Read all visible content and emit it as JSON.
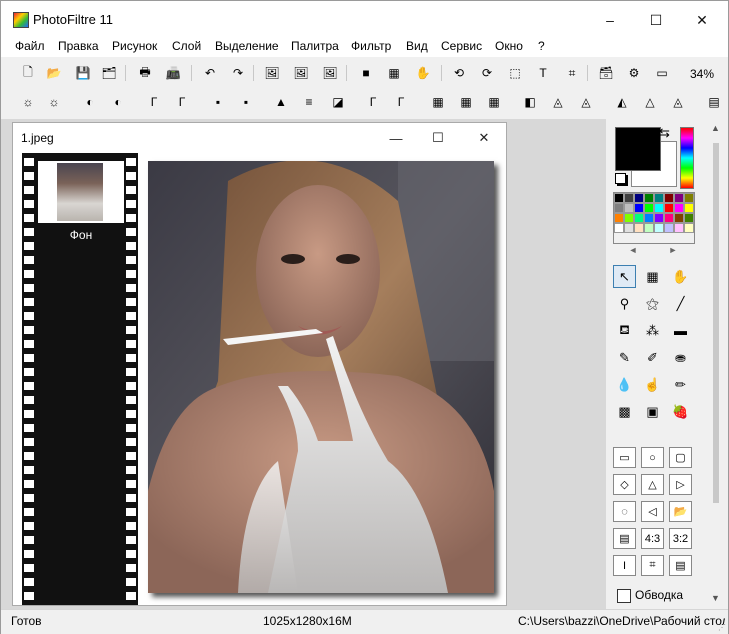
{
  "window": {
    "title": "PhotoFiltre 11",
    "min": "–",
    "max": "☐",
    "close": "✕"
  },
  "menu": [
    "Файл",
    "Правка",
    "Рисунок",
    "Слой",
    "Выделение",
    "Палитра",
    "Фильтр",
    "Вид",
    "Сервис",
    "Окно",
    "?"
  ],
  "toolbar1": {
    "icons": [
      "new-file-icon",
      "open-folder-icon",
      "save-disk-icon",
      "browse-icon",
      "print-icon",
      "scan-icon",
      "undo-icon",
      "redo-icon",
      "image-size-icon",
      "canvas-size-icon",
      "fit-image-icon",
      "gray-square-icon",
      "color-grid-icon",
      "automate-icon",
      "rotate-left-icon",
      "rotate-right-icon",
      "selection-icon",
      "text-icon",
      "crop-icon",
      "explorer-icon",
      "plugin-gear-icon",
      "window-icon"
    ],
    "glyphs": [
      "🗋",
      "📂",
      "💾",
      "🗂",
      "🖶",
      "📠",
      "↶",
      "↷",
      "🖼",
      "🖼",
      "🖼",
      "■",
      "▦",
      "✋",
      "⟲",
      "⟳",
      "⬚",
      "T",
      "⌗",
      "🗃",
      "⚙",
      "▭"
    ],
    "zoom": "34%"
  },
  "toolbar2": {
    "icons": [
      "brightness-down-icon",
      "brightness-up-icon",
      "contrast-down-icon",
      "contrast-up-icon",
      "gamma-down-icon",
      "gamma-up-icon",
      "saturation-down-icon",
      "saturation-up-icon",
      "levels-icon",
      "curves-icon",
      "bw-icon",
      "auto-gamma-icon",
      "auto-contrast-icon",
      "dither-1-icon",
      "dither-2-icon",
      "dither-3-icon",
      "blur-icon",
      "sharpen-icon",
      "sharpen-more-icon",
      "emboss-icon",
      "drop-icon",
      "drop-plus-icon",
      "rainbow-icon"
    ],
    "glyphs": [
      "☼",
      "☼",
      "◐",
      "◐",
      "Γ",
      "Γ",
      "▪",
      "▪",
      "▲",
      "≡",
      "◪",
      "Γ",
      "Γ",
      "▦",
      "▦",
      "▦",
      "◧",
      "◬",
      "◬",
      "◭",
      "△",
      "◬",
      "▤"
    ]
  },
  "document": {
    "title": "1.jpeg",
    "min": "—",
    "max": "☐",
    "close": "✕",
    "layer_label": "Фон"
  },
  "colors": {
    "foreground": "#000000",
    "background": "#ffffff",
    "palette": [
      "#000000",
      "#404040",
      "#000080",
      "#008000",
      "#008080",
      "#800000",
      "#800080",
      "#808000",
      "#808080",
      "#c0c0c0",
      "#0000ff",
      "#00ff00",
      "#00ffff",
      "#ff0000",
      "#ff00ff",
      "#ffff00",
      "#ff8000",
      "#80ff00",
      "#00ff80",
      "#0080ff",
      "#8000ff",
      "#ff0080",
      "#804000",
      "#408000",
      "#ffffff",
      "#e0e0e0",
      "#ffe0c0",
      "#c0ffc0",
      "#c0ffff",
      "#c0c0ff",
      "#ffc0ff",
      "#ffffc0"
    ]
  },
  "tools": {
    "icons": [
      "pointer-icon",
      "shape-select-icon",
      "hand-icon",
      "eyedropper-icon",
      "magic-wand-icon",
      "line-icon",
      "fill-bucket-icon",
      "spray-icon",
      "eraser-icon",
      "brush-icon",
      "advanced-brush-icon",
      "stamp-icon",
      "blur-drop-icon",
      "finger-icon",
      "clone-icon",
      "pattern-icon",
      "portrait-icon",
      "strawberry-icon"
    ],
    "glyphs": [
      "↖",
      "▦",
      "✋",
      "⚲",
      "⚝",
      "╱",
      "⛾",
      "⁂",
      "▬",
      "✎",
      "✐",
      "⛂",
      "💧",
      "☝",
      "✏",
      "▩",
      "▣",
      "🍓"
    ]
  },
  "shapes": {
    "icons": [
      "rectangle-icon",
      "ellipse-icon",
      "rounded-rect-icon",
      "diamond-icon",
      "triangle-icon",
      "triangle-right-icon",
      "lasso-icon",
      "polygon-icon",
      "open-selection-icon",
      "fill-selection-icon",
      "ratio-4-3-icon",
      "ratio-3-2-icon",
      "text-selection-icon",
      "crop-selection-icon",
      "save-selection-icon"
    ],
    "glyphs": [
      "▭",
      "○",
      "▢",
      "◇",
      "△",
      "▷",
      "◌",
      "◁",
      "📂",
      "▤",
      "4:3",
      "3:2",
      "I",
      "⌗",
      "▤"
    ],
    "outline_label": "Обводка"
  },
  "status": {
    "left": "Готов",
    "middle": "1025x1280x16M",
    "right": "C:\\Users\\bazzi\\OneDrive\\Рабочий стол"
  }
}
